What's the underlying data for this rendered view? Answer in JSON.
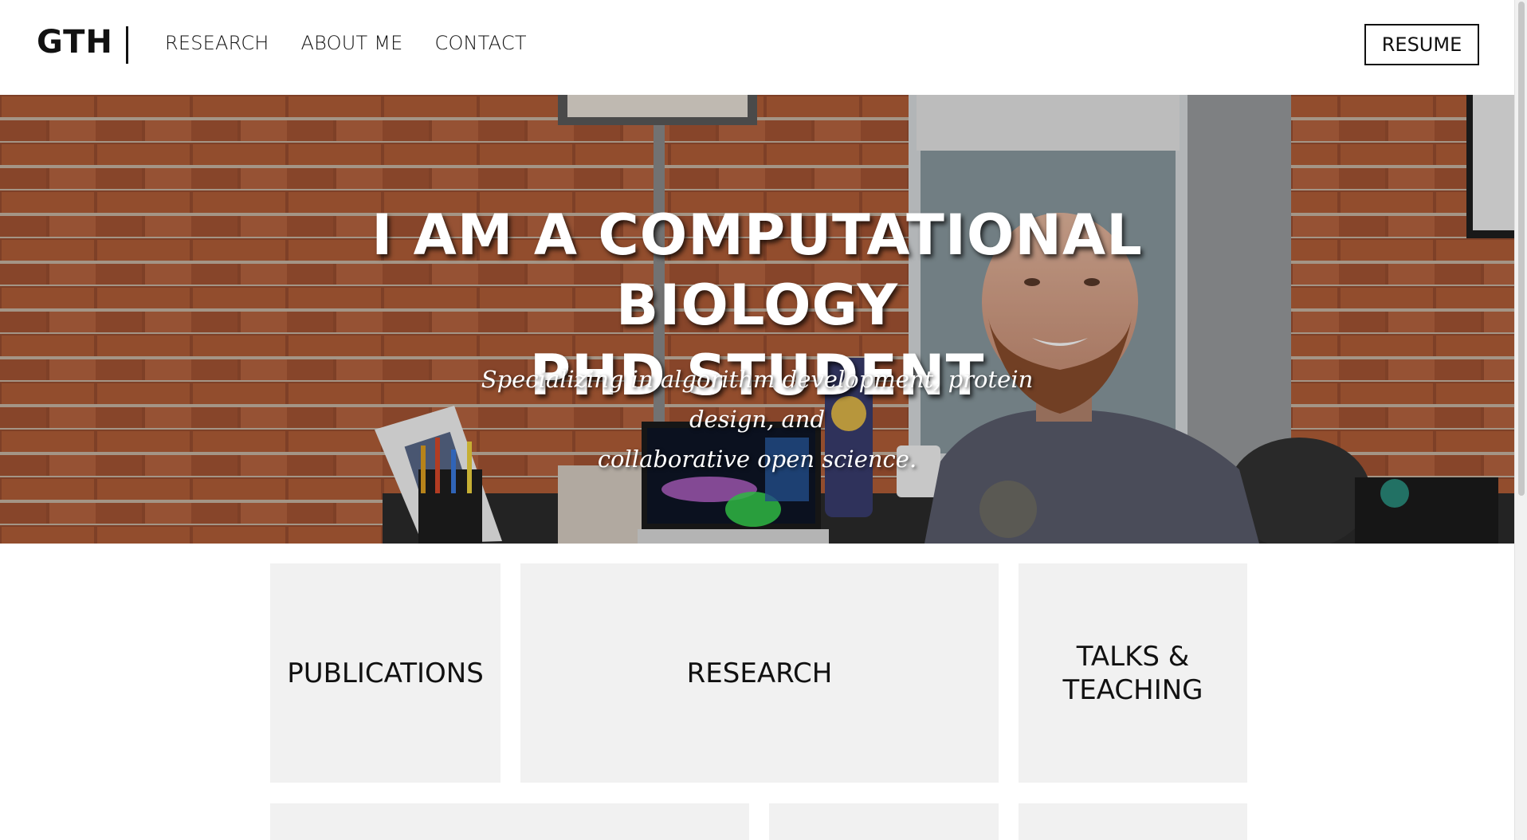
{
  "header": {
    "logo": "GTH",
    "nav": [
      "RESEARCH",
      "ABOUT ME",
      "CONTACT"
    ],
    "resume_label": "RESUME"
  },
  "hero": {
    "title_line1": "I AM A COMPUTATIONAL BIOLOGY",
    "title_line2": "PHD STUDENT",
    "subtitle_line1": "Specializing in algorithm development, protein design, and",
    "subtitle_line2": "collaborative open science."
  },
  "tiles": {
    "publications": "PUBLICATIONS",
    "research": "RESEARCH",
    "talks_line1": "TALKS &",
    "talks_line2": "TEACHING"
  },
  "colors": {
    "tile_bg": "#f1f1f1",
    "text": "#111111"
  }
}
